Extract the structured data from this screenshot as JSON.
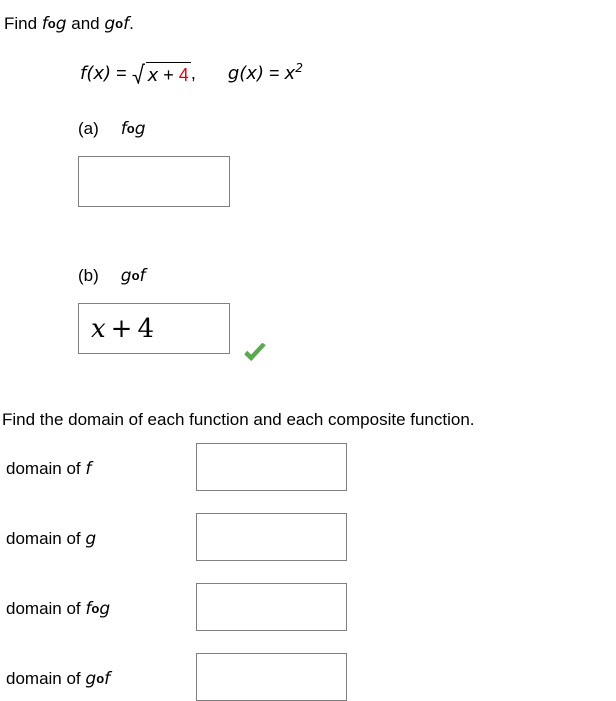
{
  "question": {
    "prompt_prefix": "Find ",
    "prompt_mid": " and ",
    "prompt_suffix": ".",
    "comp_fg_f": "f",
    "comp_fg_circ": "o",
    "comp_fg_g": "g",
    "comp_gf_g": "g",
    "comp_gf_circ": "o",
    "comp_gf_f": "f"
  },
  "definition": {
    "f_name": "f(x)",
    "equals": "=",
    "sqrt_radicand_var": "x",
    "sqrt_radicand_op": "+",
    "sqrt_radicand_const": "4",
    "comma": ",",
    "g_name": "g(x)",
    "g_equals": "=",
    "g_base": "x",
    "g_exponent": "2"
  },
  "parts": [
    {
      "tag": "(a)",
      "expr_left": "f",
      "expr_circ": "o",
      "expr_right": "g",
      "answer_value": "",
      "answer_var": "",
      "answer_op": "",
      "answer_const": "",
      "graded": false,
      "status": ""
    },
    {
      "tag": "(b)",
      "expr_left": "g",
      "expr_circ": "o",
      "expr_right": "f",
      "answer_value": "x + 4",
      "answer_var": "x",
      "answer_op": "+",
      "answer_const": "4",
      "graded": true,
      "status": "correct"
    }
  ],
  "domain_section": {
    "instruction": "Find the domain of each function and each composite function.",
    "rows": [
      {
        "label_prefix": "domain of ",
        "label_fn1": "f",
        "label_circ": "",
        "label_fn2": "",
        "value": ""
      },
      {
        "label_prefix": "domain of ",
        "label_fn1": "g",
        "label_circ": "",
        "label_fn2": "",
        "value": ""
      },
      {
        "label_prefix": "domain of ",
        "label_fn1": "f",
        "label_circ": "o",
        "label_fn2": "g",
        "value": ""
      },
      {
        "label_prefix": "domain of ",
        "label_fn1": "g",
        "label_circ": "o",
        "label_fn2": "f",
        "value": ""
      }
    ]
  },
  "colors": {
    "personalized_value": "#e8000d",
    "correct_check": "#5aa84f",
    "input_border": "#808080",
    "text": "#000000",
    "background": "#ffffff"
  },
  "icons": {
    "check": "check-mark-icon"
  }
}
